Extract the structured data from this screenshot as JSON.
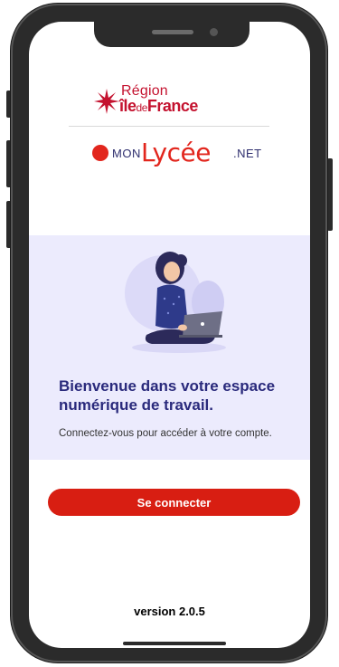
{
  "logos": {
    "region_word": "Région",
    "ile_part1": "île",
    "ile_part2": "de",
    "ile_part3": "France",
    "mon": "MON",
    "lycee": "Lycée",
    "net": ".NET"
  },
  "welcome": {
    "title": "Bienvenue dans votre espace numérique de travail.",
    "subtitle": "Connectez-vous pour accéder à votre compte."
  },
  "actions": {
    "connect_label": "Se connecter"
  },
  "footer": {
    "version": "version 2.0.5"
  },
  "colors": {
    "brand_red": "#d81e12",
    "panel_bg": "#ecebfd",
    "title_blue": "#2a2a7c"
  }
}
